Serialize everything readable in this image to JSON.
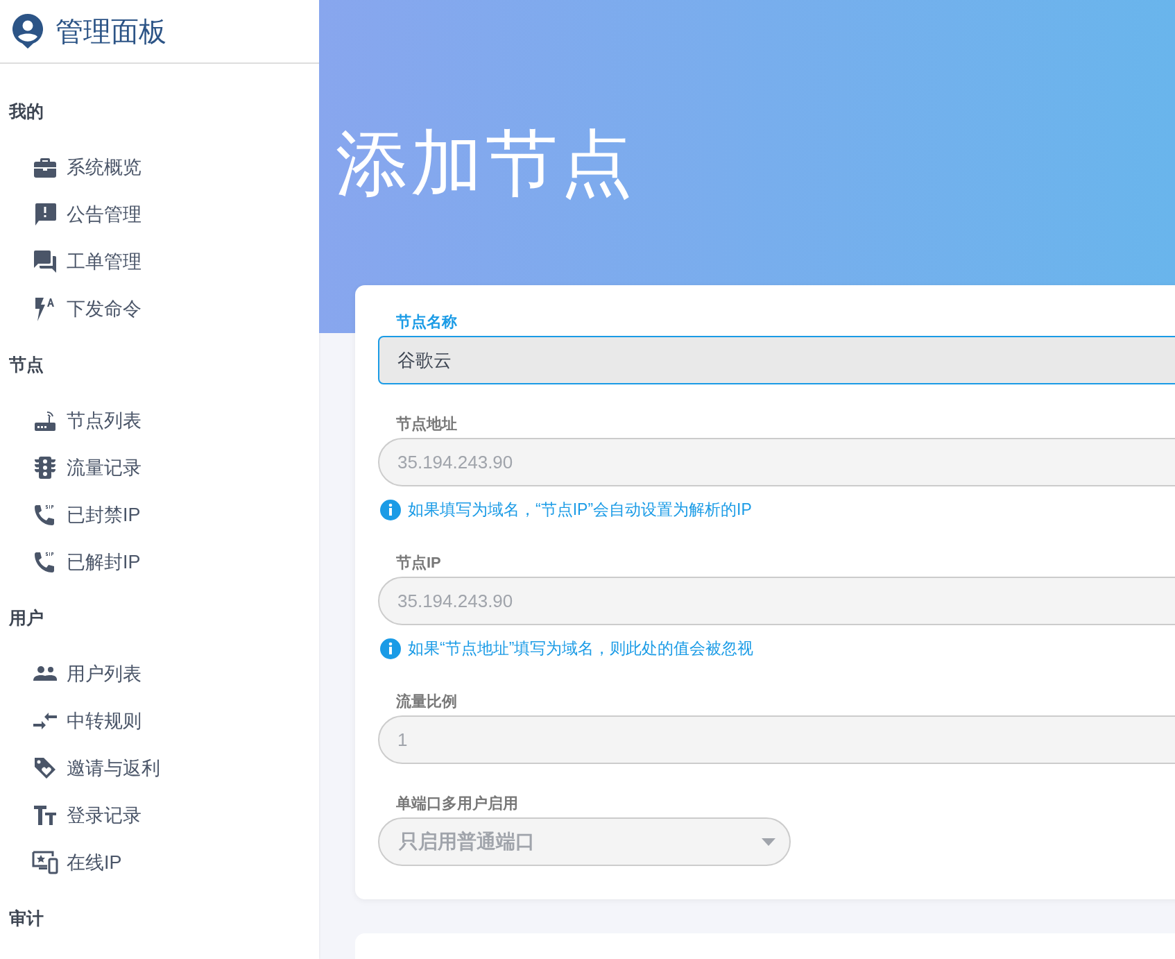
{
  "brand": {
    "title": "管理面板"
  },
  "sidebar": {
    "sections": [
      {
        "title": "我的",
        "items": [
          {
            "label": "系统概览"
          },
          {
            "label": "公告管理"
          },
          {
            "label": "工单管理"
          },
          {
            "label": "下发命令"
          }
        ]
      },
      {
        "title": "节点",
        "items": [
          {
            "label": "节点列表"
          },
          {
            "label": "流量记录"
          },
          {
            "label": "已封禁IP"
          },
          {
            "label": "已解封IP"
          }
        ]
      },
      {
        "title": "用户",
        "items": [
          {
            "label": "用户列表"
          },
          {
            "label": "中转规则"
          },
          {
            "label": "邀请与返利"
          },
          {
            "label": "登录记录"
          },
          {
            "label": "在线IP"
          }
        ]
      },
      {
        "title": "审计"
      }
    ]
  },
  "page": {
    "title": "添加节点"
  },
  "form": {
    "fields": [
      {
        "kind": "text",
        "label": "节点名称",
        "value": "谷歌云",
        "focused": true
      },
      {
        "kind": "text",
        "label": "节点地址",
        "placeholder": "35.194.243.90",
        "focused": false,
        "hint": "如果填写为域名，“节点IP”会自动设置为解析的IP"
      },
      {
        "kind": "text",
        "label": "节点IP",
        "placeholder": "35.194.243.90",
        "focused": false,
        "hint": "如果“节点地址”填写为域名，则此处的值会被忽视"
      },
      {
        "kind": "text",
        "label": "流量比例",
        "placeholder": "1",
        "focused": false
      },
      {
        "kind": "select",
        "label": "单端口多用户启用",
        "value": "只启用普通端口",
        "focused": false
      }
    ]
  }
}
